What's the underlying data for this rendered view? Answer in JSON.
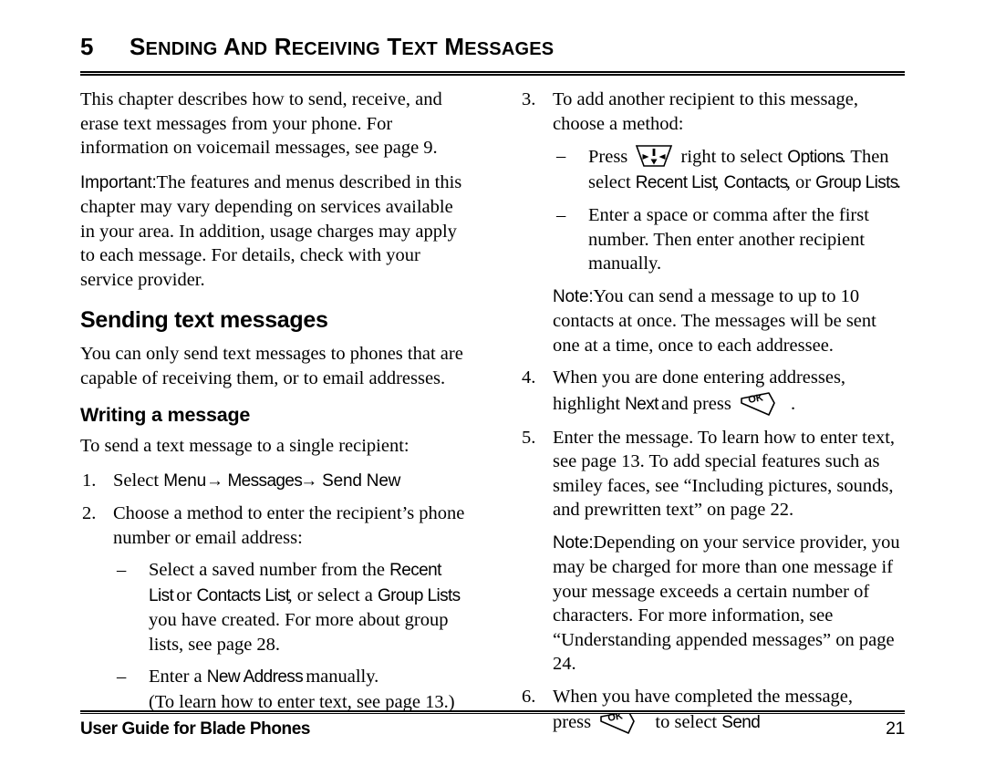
{
  "header": {
    "chapter_number": "5",
    "chapter_title_first": "S",
    "chapter_title_rest": "ENDING AND ",
    "chapter_title": "SENDING AND RECEIVING TEXT MESSAGES",
    "parts": [
      {
        "cap": "S",
        "rest": "ENDING"
      },
      {
        "cap": "A",
        "rest": "ND"
      },
      {
        "cap": "R",
        "rest": "ECEIVING"
      },
      {
        "cap": "T",
        "rest": "EXT"
      },
      {
        "cap": "M",
        "rest": "ESSAGES"
      }
    ]
  },
  "left_column": {
    "intro_paragraph": "This chapter describes how to send, receive, and erase text messages from your phone. For information on voicemail messages, see page 9.",
    "important_label": "Important:",
    "important_text": "The features and menus described in this chapter may vary depending on services available in your area. In addition, usage charges may apply to each message. For details, check with your service provider.",
    "section_heading": "Sending text messages",
    "section_paragraph": "You can only send text messages to phones that are capable of receiving them, or to email addresses.",
    "subsection_heading": "Writing a message",
    "subsection_lead": "To send a text message to a single recipient:",
    "step1": {
      "marker": "1.",
      "text_before": "Select ",
      "ui_menu": "Menu",
      "arrow1": "→",
      "ui_messages": " Messages",
      "arrow2": "→",
      "ui_send_new": " Send New"
    },
    "step2": {
      "marker": "2.",
      "text": "Choose a method to enter the recipient’s phone number or email address:"
    },
    "sub1": {
      "marker": "–",
      "part1": "Select a saved number from the ",
      "ui_recent_list": "Recent List",
      "part2": " or ",
      "ui_contacts_list": "Contacts List",
      "part3": ", or select a ",
      "ui_group_lists": "Group Lists",
      "part4": " you have created. For more about group lists, see page 28."
    },
    "sub2": {
      "marker": "–",
      "part1": "Enter a ",
      "ui_new_address": "New Address",
      "part2": " manually.",
      "part3": "(To learn how to enter text, see page 13.)"
    }
  },
  "right_column": {
    "step3": {
      "marker": "3.",
      "text": "To add another recipient to this message, choose a method:"
    },
    "sub3a": {
      "marker": "–",
      "part1": "Press ",
      "icon": "nav-key-icon",
      "part2": " right to select ",
      "ui_options": "Options",
      "part3": ". Then select ",
      "ui_recent_list": "Recent List",
      "part4": ", ",
      "ui_contacts": "Contacts",
      "part5": ", or ",
      "ui_group_lists": "Group Lists",
      "part6": "."
    },
    "sub3b": {
      "marker": "–",
      "text": "Enter a space or comma after the first number. Then enter another recipient manually."
    },
    "note1_label": "Note:",
    "note1_text": "You can send a message to up to 10 contacts at once. The messages will be sent one at a time, once to each addressee.",
    "step4": {
      "marker": "4.",
      "part1": "When you are done entering addresses, highlight ",
      "ui_next": "Next",
      "part2": " and press ",
      "icon": "ok-key-icon",
      "part3": "."
    },
    "step5": {
      "marker": "5.",
      "text": "Enter the message. To learn how to enter text, see page 13. To add special features such as smiley faces, see “Including pictures, sounds, and prewritten text” on page 22."
    },
    "note2_label": "Note:",
    "note2_text": "Depending on your service provider, you may be charged for more than one message if your message exceeds a certain number of characters. For more information, see “Understanding appended messages” on page 24.",
    "step6": {
      "marker": "6.",
      "part1": "When you have completed the message,",
      "part2": "press ",
      "icon": "ok-key-icon",
      "part3": " to select ",
      "ui_send": "Send",
      "part4": "."
    }
  },
  "footer": {
    "guide_title": "User Guide for Blade Phones",
    "page_number": "21"
  },
  "icons": {
    "nav_key_label": "nav-key-icon",
    "ok_key_label": "OK"
  },
  "colors": {
    "text": "#000000",
    "background": "#ffffff",
    "rule": "#000000"
  }
}
